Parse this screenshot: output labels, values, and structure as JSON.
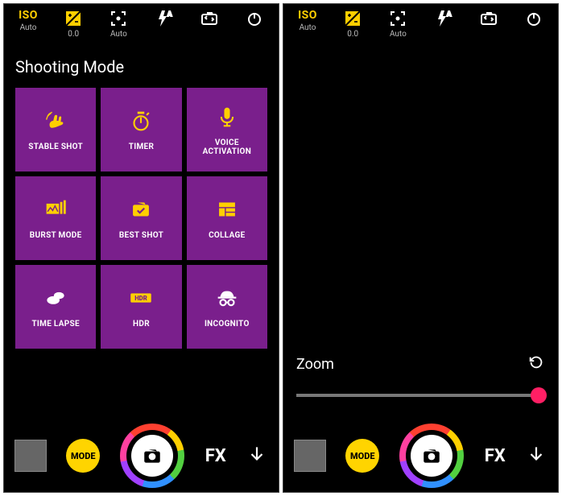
{
  "topbar": {
    "iso_tag": "ISO",
    "iso_sub": "Auto",
    "ev_value": "0.0",
    "focus_sub": "Auto"
  },
  "shooting_mode": {
    "title": "Shooting Mode",
    "tiles": {
      "stable_shot": "STABLE SHOT",
      "timer": "TIMER",
      "voice_activation": "VOICE\nACTIVATION",
      "burst_mode": "BURST MODE",
      "best_shot": "BEST SHOT",
      "collage": "COLLAGE",
      "time_lapse": "TIME LAPSE",
      "hdr": "HDR",
      "incognito": "INCOGNITO"
    }
  },
  "zoom": {
    "label": "Zoom"
  },
  "bottombar": {
    "mode_label": "MODE",
    "fx_label": "FX"
  }
}
